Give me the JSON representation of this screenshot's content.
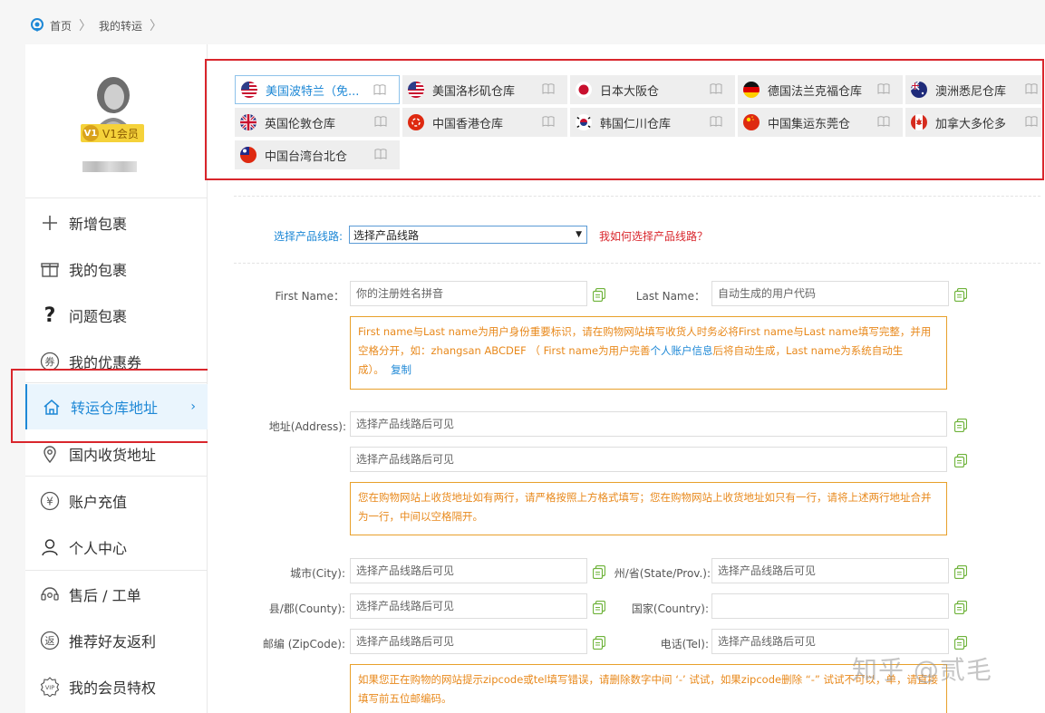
{
  "breadcrumb": {
    "home": "首页",
    "current": "我的转运"
  },
  "user": {
    "vip_level": "V1会员",
    "vip_short": "V1"
  },
  "nav": [
    {
      "label": "新增包裹",
      "icon": "plus-icon"
    },
    {
      "label": "我的包裹",
      "icon": "gift-box-icon"
    },
    {
      "label": "问题包裹",
      "icon": "question-icon"
    },
    {
      "label": "我的优惠券",
      "icon": "coupon-icon"
    },
    {
      "label": "转运仓库地址",
      "icon": "home-icon",
      "active": true
    },
    {
      "label": "国内收货地址",
      "icon": "location-pin-icon"
    },
    {
      "label": "账户充值",
      "icon": "yen-icon"
    },
    {
      "label": "个人中心",
      "icon": "user-icon"
    },
    {
      "label": "售后 / 工单",
      "icon": "headset-icon"
    },
    {
      "label": "推荐好友返利",
      "icon": "rebate-icon"
    },
    {
      "label": "我的会员特权",
      "icon": "vip-icon"
    }
  ],
  "warehouses": [
    {
      "label": "美国波特兰（免...",
      "flag": "us"
    },
    {
      "label": "美国洛杉矶仓库",
      "flag": "us"
    },
    {
      "label": "日本大阪仓",
      "flag": "jp"
    },
    {
      "label": "德国法兰克福仓库",
      "flag": "de"
    },
    {
      "label": "澳洲悉尼仓库",
      "flag": "au"
    },
    {
      "label": "英国伦敦仓库",
      "flag": "gb"
    },
    {
      "label": "中国香港仓库",
      "flag": "hk"
    },
    {
      "label": "韩国仁川仓库",
      "flag": "kr"
    },
    {
      "label": "中国集运东莞仓",
      "flag": "cn"
    },
    {
      "label": "加拿大多伦多",
      "flag": "ca"
    },
    {
      "label": "中国台湾台北仓",
      "flag": "tw"
    }
  ],
  "route": {
    "label": "选择产品线路:",
    "value": "选择产品线路",
    "help": "我如何选择产品线路？"
  },
  "form": {
    "first_name_label": "First Name：",
    "first_name_placeholder": "你的注册姓名拼音",
    "last_name_label": "Last Name：",
    "last_name_placeholder": "自动生成的用户代码",
    "name_note_a": "First name与Last name为用户身份重要标识，请在购物网站填写收货人时务必将First name与Last name填写完整，并用空格分开，如：zhangsan ABCDEF （ First name为用户完善",
    "name_note_link": "个人账户信息",
    "name_note_b": "后将自动生成，Last name为系统自动生成）。",
    "name_note_copy": "复制",
    "address_label": "地址(Address):",
    "address1_placeholder": "选择产品线路后可见",
    "address2_placeholder": "选择产品线路后可见",
    "address_note": "您在购物网站上收货地址如有两行，请严格按照上方格式填写；您在购物网站上收货地址如只有一行，请将上述两行地址合并为一行，中间以空格隔开。",
    "city_label": "城市(City):",
    "city_placeholder": "选择产品线路后可见",
    "state_label": "州/省(State/Prov.):",
    "state_placeholder": "选择产品线路后可见",
    "county_label": "县/郡(County):",
    "county_placeholder": "选择产品线路后可见",
    "country_label": "国家(Country):",
    "country_placeholder": "",
    "zip_label": "邮编 (ZipCode):",
    "zip_placeholder": "选择产品线路后可见",
    "tel_label": "电话(Tel):",
    "tel_placeholder": "选择产品线路后可见",
    "zip_note": "如果您正在购物的网站提示zipcode或tel填写错误，请删除数字中间 ‘-’ 试试，如果zipcode删除 “-” 试试不可以，单，请直接填写前五位邮编码。"
  },
  "watermark": "知乎 @贰毛",
  "colors": {
    "accent": "#1e88d6",
    "highlight_box": "#d9262c",
    "note_border": "#e8a02b",
    "note_text": "#e8891c",
    "vip_gold": "#f5d23a"
  }
}
